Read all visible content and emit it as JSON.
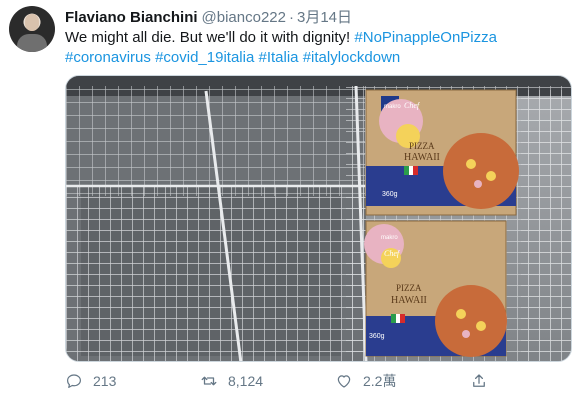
{
  "author": {
    "name": "Flaviano Bianchini",
    "handle": "@bianco222",
    "separator": "·",
    "date": "3月14日"
  },
  "tweet": {
    "text_line1": "We might all die. But we'll do it with dignity! ",
    "hashtags": [
      "#NoPinappleOnPizza",
      "#coronavirus",
      "#covid_19italia",
      "#Italia",
      "#italylockdown"
    ]
  },
  "media": {
    "pizza_box_top": {
      "brand": "makro",
      "sub": "Chef",
      "title1": "PIZZA",
      "title2": "HAWAII",
      "weight": "360g"
    },
    "pizza_box_bottom": {
      "brand": "makro",
      "sub": "Chef",
      "title1": "PIZZA",
      "title2": "HAWAII",
      "weight": "360g"
    }
  },
  "actions": {
    "reply_count": "213",
    "retweet_count": "8,124",
    "like_count": "2.2萬",
    "reply_icon": "reply-icon",
    "retweet_icon": "retweet-icon",
    "like_icon": "heart-icon",
    "share_icon": "share-icon"
  },
  "colors": {
    "hashtag": "#1b95e0",
    "secondary_text": "#657786",
    "border": "#ccd6dd"
  }
}
